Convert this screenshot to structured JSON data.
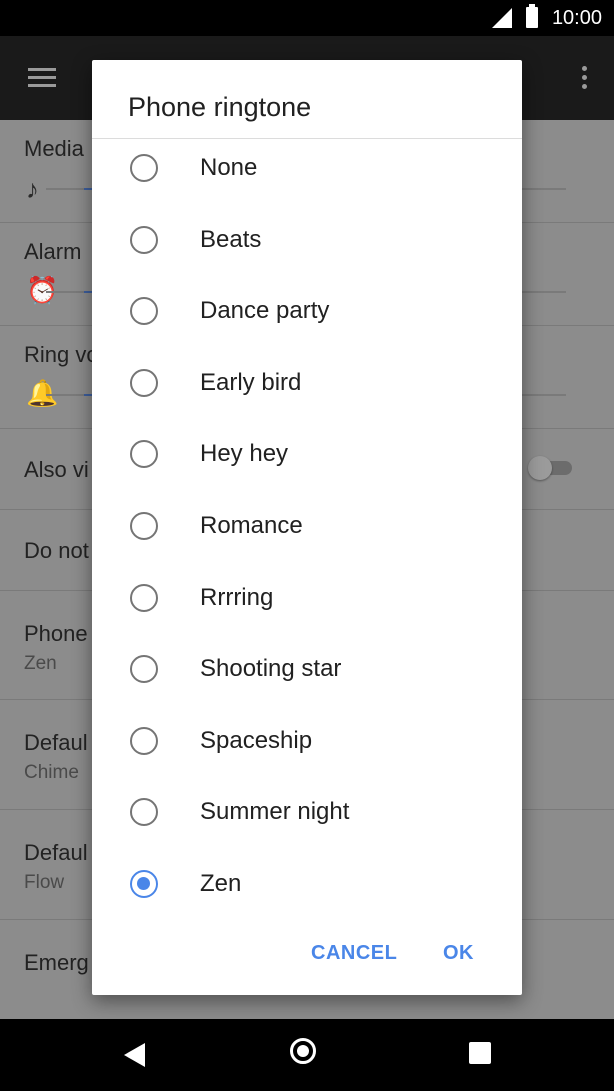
{
  "status_bar": {
    "time": "10:00",
    "icons": [
      "signal-icon",
      "battery-icon"
    ]
  },
  "toolbar": {
    "menu_icon": "hamburger-icon",
    "more_icon": "overflow-icon"
  },
  "settings": {
    "rows": [
      {
        "title": "Media",
        "icon": "music-note-icon"
      },
      {
        "title": "Alarm",
        "icon": "alarm-icon"
      },
      {
        "title": "Ring vo",
        "icon": "bell-icon"
      },
      {
        "title": "Also vi"
      },
      {
        "title": "Do not"
      },
      {
        "title": "Phone",
        "sub": "Zen"
      },
      {
        "title": "Defaul",
        "sub": "Chime"
      },
      {
        "title": "Defaul",
        "sub": "Flow"
      },
      {
        "title": "Emerg"
      }
    ]
  },
  "dialog": {
    "title": "Phone ringtone",
    "options": [
      {
        "label": "None",
        "selected": false
      },
      {
        "label": "Beats",
        "selected": false
      },
      {
        "label": "Dance party",
        "selected": false
      },
      {
        "label": "Early bird",
        "selected": false
      },
      {
        "label": "Hey hey",
        "selected": false
      },
      {
        "label": "Romance",
        "selected": false
      },
      {
        "label": "Rrrring",
        "selected": false
      },
      {
        "label": "Shooting star",
        "selected": false
      },
      {
        "label": "Spaceship",
        "selected": false
      },
      {
        "label": "Summer night",
        "selected": false
      },
      {
        "label": "Zen",
        "selected": true
      }
    ],
    "cancel_label": "CANCEL",
    "ok_label": "OK"
  },
  "colors": {
    "accent": "#4a86e8",
    "scrim": "#8a8a8a"
  }
}
